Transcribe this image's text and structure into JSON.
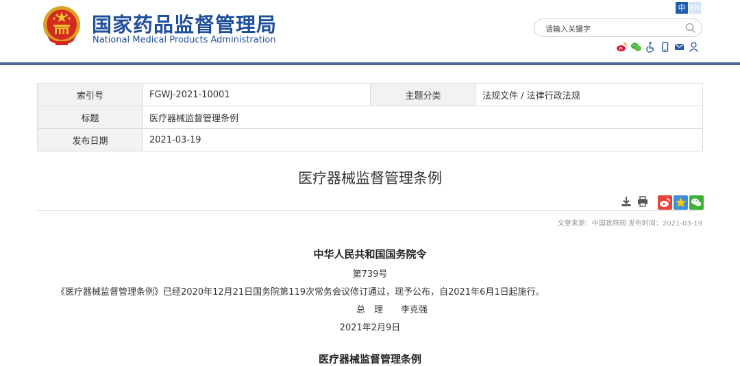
{
  "header": {
    "site_title_cn": "国家药品监督管理局",
    "site_title_en": "National Medical Products Administration",
    "lang_cn": "中",
    "lang_en": "EN",
    "search_placeholder": "请输入关键字",
    "brand_color": "#1f4f9c"
  },
  "meta": {
    "index_label": "索引号",
    "index_value": "FGWJ-2021-10001",
    "category_label": "主题分类",
    "category_value": "法规文件 / 法律行政法规",
    "title_label": "标题",
    "title_value": "医疗器械监督管理条例",
    "date_label": "发布日期",
    "date_value": "2021-03-19"
  },
  "article": {
    "title": "医疗器械监督管理条例",
    "source_line": "文章来源：中国政府网 发布时间：2021-03-19",
    "decree_title": "中华人民共和国国务院令",
    "decree_no": "第739号",
    "decree_body": "《医疗器械监督管理条例》已经2020年12月21日国务院第119次常务会议修订通过，现予公布，自2021年6月1日起施行。",
    "premier_title": "总　理",
    "premier_name": "李克强",
    "decree_date": "2021年2月9日",
    "next_heading": "医疗器械监督管理条例"
  },
  "icons": {
    "header": [
      "weibo-icon",
      "wechat-icon",
      "accessibility-icon",
      "mobile-icon",
      "mail-icon",
      "user-icon"
    ],
    "tools": [
      "download-icon",
      "print-icon"
    ],
    "share": [
      "weibo-share-icon",
      "favorite-star-icon",
      "wechat-share-icon"
    ]
  }
}
